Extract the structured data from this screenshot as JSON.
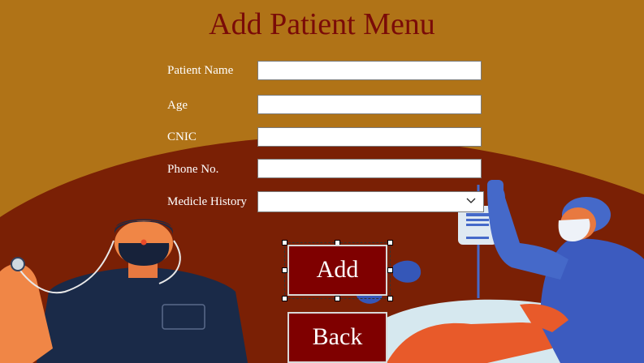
{
  "form": {
    "title": "Add Patient Menu",
    "fields": [
      {
        "label": "Patient Name",
        "value": "",
        "placeholder": ""
      },
      {
        "label": "Age",
        "value": "",
        "placeholder": ""
      },
      {
        "label": "CNIC",
        "value": "",
        "placeholder": ""
      },
      {
        "label": "Phone No.",
        "value": "",
        "placeholder": ""
      }
    ],
    "history": {
      "label": "Medicle History",
      "value": "",
      "icon": "chevron-down-icon"
    }
  },
  "buttons": {
    "add": "Add",
    "back": "Back"
  },
  "colors": {
    "background": "#b07317",
    "dark_band": "#7a2005",
    "title": "#7a0b08",
    "button": "#7f0000"
  }
}
